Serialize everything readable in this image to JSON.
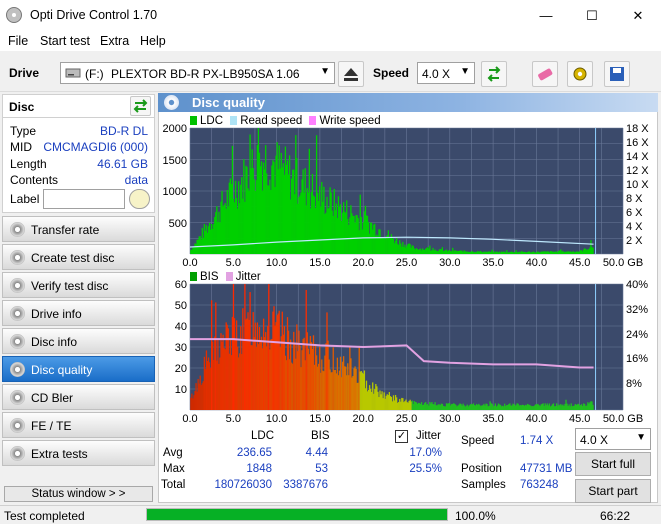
{
  "window": {
    "title": "Opti Drive Control 1.70",
    "minimize": "—",
    "maximize": "☐",
    "close": "✕"
  },
  "menu": [
    "File",
    "Start test",
    "Extra",
    "Help"
  ],
  "toolbar": {
    "drive_label": "Drive",
    "drive_letter": "(F:)",
    "drive_name": "PLEXTOR BD-R  PX-LB950SA 1.06",
    "speed_label": "Speed",
    "speed_value": "4.0 X"
  },
  "disc": {
    "header": "Disc",
    "rows": [
      {
        "k": "Type",
        "v": "BD-R DL"
      },
      {
        "k": "MID",
        "v": "CMCMAGDI6 (000)"
      },
      {
        "k": "Length",
        "v": "46.61 GB"
      },
      {
        "k": "Contents",
        "v": "data"
      },
      {
        "k": "Label",
        "v": ""
      }
    ]
  },
  "nav": [
    "Transfer rate",
    "Create test disc",
    "Verify test disc",
    "Drive info",
    "Disc info",
    "Disc quality",
    "CD Bler",
    "FE / TE",
    "Extra tests"
  ],
  "active_nav": "Disc quality",
  "status_window_btn": "Status window > >",
  "panel": {
    "title": "Disc quality"
  },
  "chart_data": [
    {
      "type": "area",
      "title": "",
      "legend": [
        "LDC",
        "Read speed",
        "Write speed"
      ],
      "colors": {
        "LDC": "#00c000",
        "Read speed": "#aee3f5",
        "Write speed": "#ff80ff"
      },
      "x_ticks": [
        "0.0",
        "5.0",
        "10.0",
        "15.0",
        "20.0",
        "25.0",
        "30.0",
        "35.0",
        "40.0",
        "45.0",
        "50.0 GB"
      ],
      "y_ticks_left": [
        "2000",
        "1500",
        "1000",
        "500"
      ],
      "y_ticks_right": [
        "18 X",
        "16 X",
        "14 X",
        "12 X",
        "10 X",
        "8 X",
        "6 X",
        "4 X",
        "2 X"
      ],
      "xlim": [
        0,
        50
      ],
      "ylim": [
        0,
        2000
      ],
      "series": [
        {
          "name": "LDC",
          "x": [
            0,
            2,
            4,
            6,
            8,
            9,
            10,
            12,
            14,
            16,
            18,
            20,
            22,
            24,
            26,
            30,
            35,
            40,
            45,
            46.6
          ],
          "values": [
            60,
            520,
            1000,
            1400,
            1800,
            1840,
            1700,
            1450,
            1230,
            1020,
            830,
            640,
            460,
            240,
            110,
            60,
            40,
            40,
            50,
            150
          ]
        },
        {
          "name": "Read speed",
          "x": [
            0,
            5,
            10,
            15,
            20,
            25,
            30,
            35,
            40,
            46.6
          ],
          "values": [
            1.0,
            1.3,
            1.7,
            2.0,
            2.3,
            2.4,
            2.3,
            2.1,
            1.8,
            1.4
          ]
        }
      ]
    },
    {
      "type": "area",
      "title": "",
      "legend": [
        "BIS",
        "Jitter"
      ],
      "colors": {
        "BIS": "#c00000",
        "Jitter": "#e2a2e2"
      },
      "x_ticks": [
        "0.0",
        "5.0",
        "10.0",
        "15.0",
        "20.0",
        "25.0",
        "30.0",
        "35.0",
        "40.0",
        "45.0",
        "50.0 GB"
      ],
      "y_ticks_left": [
        "60",
        "50",
        "40",
        "30",
        "20",
        "10"
      ],
      "y_ticks_right": [
        "40%",
        "32%",
        "24%",
        "16%",
        "8%"
      ],
      "xlim": [
        0,
        50
      ],
      "ylim": [
        0,
        60
      ],
      "series": [
        {
          "name": "BIS",
          "x": [
            0,
            2,
            4,
            6,
            8,
            10,
            12,
            14,
            16,
            18,
            20,
            22,
            24,
            26,
            30,
            35,
            40,
            45,
            46.6
          ],
          "values": [
            5,
            28,
            40,
            44,
            50,
            45,
            38,
            33,
            30,
            25,
            18,
            10,
            6,
            4,
            3,
            3,
            3,
            3,
            4
          ]
        },
        {
          "name": "Jitter",
          "x": [
            0,
            5,
            10,
            15,
            20,
            25,
            27,
            30,
            35,
            40,
            45,
            46.6
          ],
          "values": [
            22.5,
            22.5,
            21.5,
            20.5,
            20,
            20.5,
            15.5,
            15,
            14.5,
            14.5,
            13.5,
            13.5
          ]
        }
      ]
    }
  ],
  "stats": {
    "cols": [
      "LDC",
      "BIS"
    ],
    "jitter_label": "Jitter",
    "rows": [
      {
        "label": "Avg",
        "ldc": "236.65",
        "bis": "4.44",
        "jitter": "17.0%"
      },
      {
        "label": "Max",
        "ldc": "1848",
        "bis": "53",
        "jitter": "25.5%"
      },
      {
        "label": "Total",
        "ldc": "180726030",
        "bis": "3387676",
        "jitter": ""
      }
    ],
    "speed_label": "Speed",
    "speed_value": "1.74 X",
    "position_label": "Position",
    "position_value": "47731 MB",
    "samples_label": "Samples",
    "samples_value": "763248",
    "speed_select": "4.0 X",
    "start_full": "Start full",
    "start_part": "Start part"
  },
  "status": {
    "text": "Test completed",
    "progress": 1.0,
    "percent": "100.0%",
    "time": "66:22"
  }
}
